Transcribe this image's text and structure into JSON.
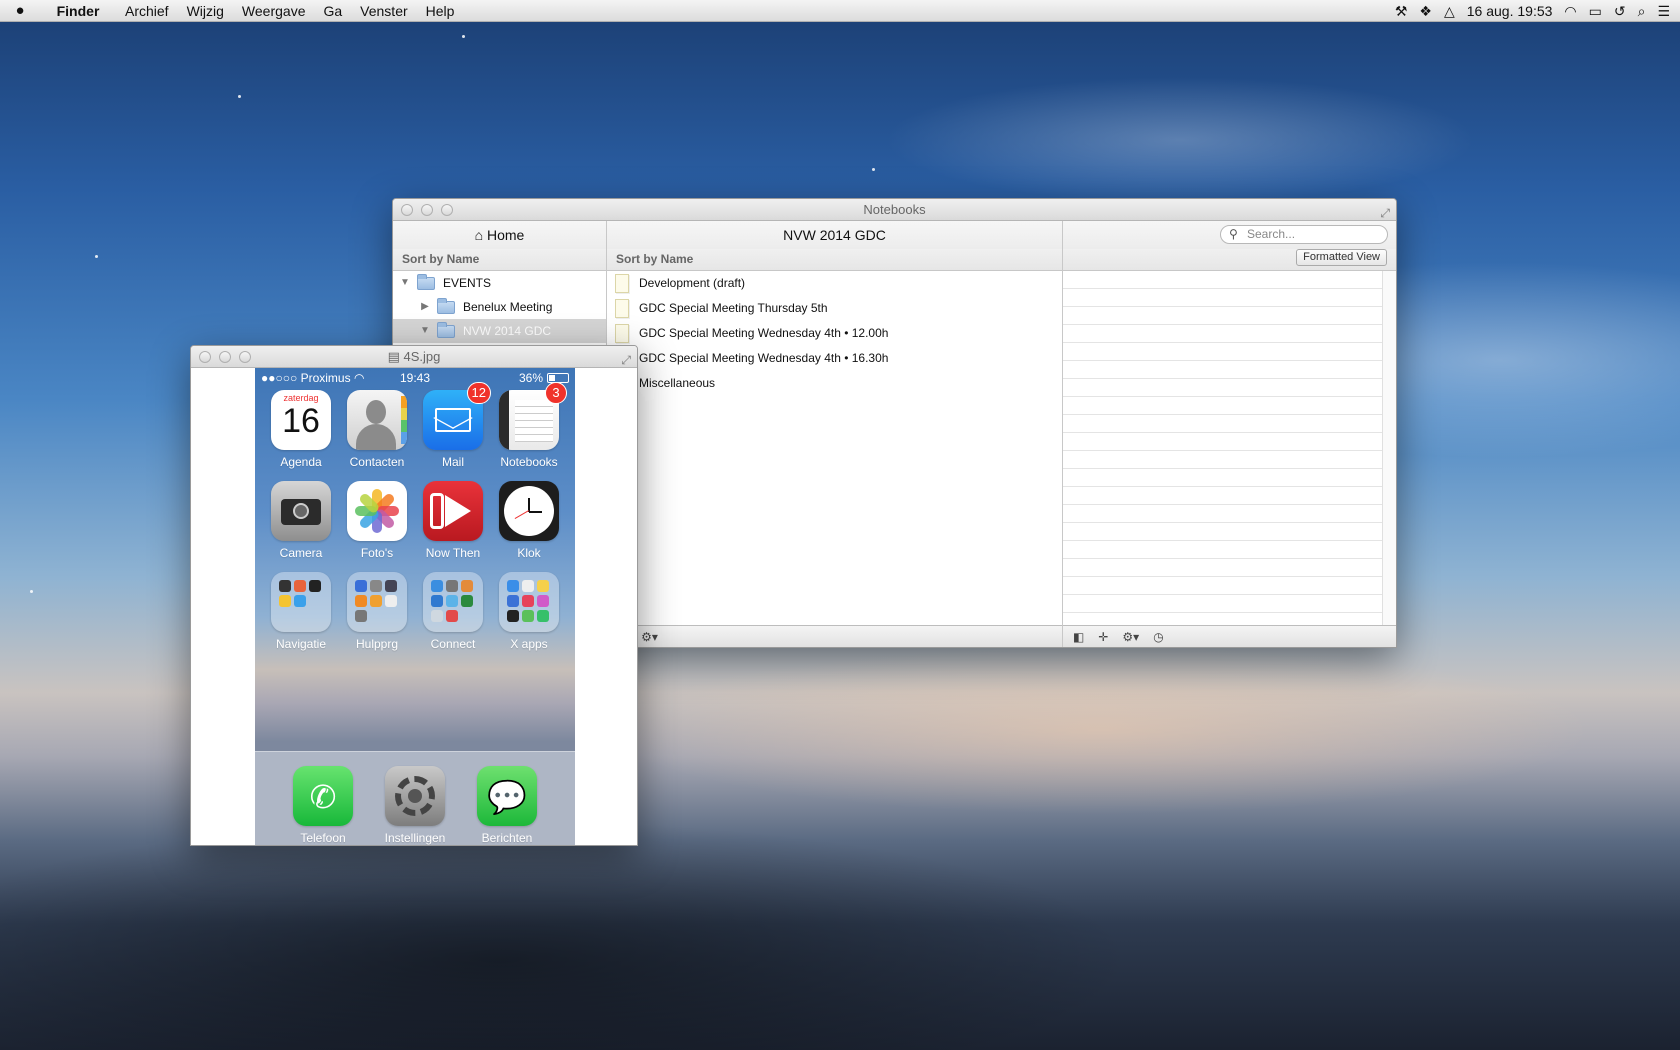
{
  "menubar": {
    "app_name": "Finder",
    "items": [
      "Archief",
      "Wijzig",
      "Weergave",
      "Ga",
      "Venster",
      "Help"
    ],
    "clock": "16 aug.  19:53"
  },
  "notebooks_window": {
    "title": "Notebooks",
    "left_header": "⌂ Home",
    "left_sort": "Sort by Name",
    "tree": [
      {
        "label": "EVENTS",
        "level": 0,
        "expanded": true,
        "selected": false
      },
      {
        "label": "Benelux Meeting",
        "level": 1,
        "expanded": false,
        "selected": false
      },
      {
        "label": "NVW 2014 GDC",
        "level": 1,
        "expanded": true,
        "selected": true
      }
    ],
    "middle_header": "NVW 2014 GDC",
    "middle_sort": "Sort by Name",
    "notes": [
      "Development (draft)",
      "GDC Special Meeting Thursday 5th",
      "GDC Special Meeting Wednesday 4th • 12.00h",
      "GDC Special Meeting Wednesday 4th • 16.30h",
      "Miscellaneous"
    ],
    "search_placeholder": "Search...",
    "formatted_view_label": "Formatted View"
  },
  "viewer_window": {
    "title": "4S.jpg",
    "phone": {
      "carrier": "●●○○○ Proximus",
      "time": "19:43",
      "battery": "36%",
      "battery_level": 0.36,
      "calendar_day": "zaterdag",
      "calendar_date": "16",
      "apps": [
        {
          "label": "Agenda",
          "badge": ""
        },
        {
          "label": "Contacten",
          "badge": ""
        },
        {
          "label": "Mail",
          "badge": "12"
        },
        {
          "label": "Notebooks",
          "badge": "3"
        },
        {
          "label": "Camera",
          "badge": ""
        },
        {
          "label": "Foto's",
          "badge": ""
        },
        {
          "label": "Now Then",
          "badge": ""
        },
        {
          "label": "Klok",
          "badge": ""
        },
        {
          "label": "Navigatie",
          "badge": ""
        },
        {
          "label": "Hulpprg",
          "badge": ""
        },
        {
          "label": "Connect",
          "badge": ""
        },
        {
          "label": "X apps",
          "badge": ""
        }
      ],
      "dock": [
        {
          "label": "Telefoon"
        },
        {
          "label": "Instellingen"
        },
        {
          "label": "Berichten"
        }
      ]
    }
  }
}
